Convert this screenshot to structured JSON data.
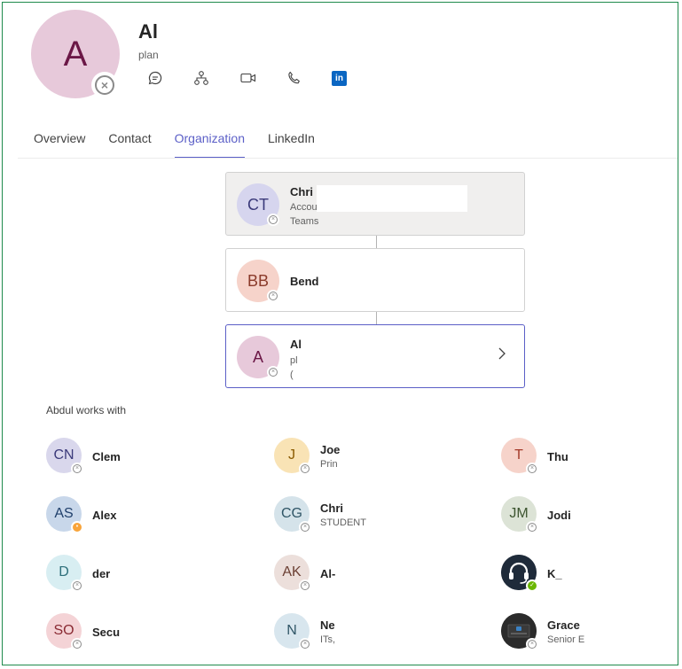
{
  "profile": {
    "initials": "A",
    "name": "Al",
    "title": "plan",
    "actions": [
      "chat-icon",
      "org-chart-icon",
      "video-call-icon",
      "phone-icon",
      "linkedin-icon"
    ],
    "linkedin_glyph": "in"
  },
  "tabs": [
    {
      "label": "Overview",
      "active": false
    },
    {
      "label": "Contact",
      "active": false
    },
    {
      "label": "Organization",
      "active": true
    },
    {
      "label": "LinkedIn",
      "active": false
    }
  ],
  "org_chart": {
    "manager": {
      "initials": "CT",
      "name": "Chri",
      "line1": "Accou",
      "line2": "Teams"
    },
    "middle": {
      "initials": "BB",
      "name": "Bend"
    },
    "self": {
      "initials": "A",
      "name": "Al",
      "line1": "pl",
      "line2": "("
    }
  },
  "works_with": {
    "label": "Abdul works with",
    "people": [
      {
        "initials": "CN",
        "name": "Clem",
        "sub": "",
        "status": "offline"
      },
      {
        "initials": "J",
        "name": "Joe",
        "sub": "Prin",
        "status": "offline"
      },
      {
        "initials": "T",
        "name": "Thu",
        "sub": "",
        "status": "offline"
      },
      {
        "initials": "AS",
        "name": "Alex",
        "sub": "",
        "status": "away"
      },
      {
        "initials": "CG",
        "name": "Chri",
        "sub": "STUDENT",
        "status": "offline"
      },
      {
        "initials": "JM",
        "name": "Jodi",
        "sub": "",
        "status": "offline"
      },
      {
        "initials": "D",
        "name": "der",
        "sub": "",
        "status": "offline"
      },
      {
        "initials": "AK",
        "name": "Al-",
        "sub": "",
        "status": "offline"
      },
      {
        "initials": "",
        "name": "K_",
        "sub": "",
        "status": "available"
      },
      {
        "initials": "SO",
        "name": "Secu",
        "sub": "",
        "status": "offline"
      },
      {
        "initials": "N",
        "name": "Ne",
        "sub": "ITs,",
        "status": "offline"
      },
      {
        "initials": "",
        "name": "Grace",
        "sub": "Senior E",
        "status": "offline"
      }
    ]
  },
  "colors": {
    "accent": "#5b5fc7",
    "offline": "#8a8a8a",
    "away": "#f8a43a",
    "available": "#6bb700"
  }
}
